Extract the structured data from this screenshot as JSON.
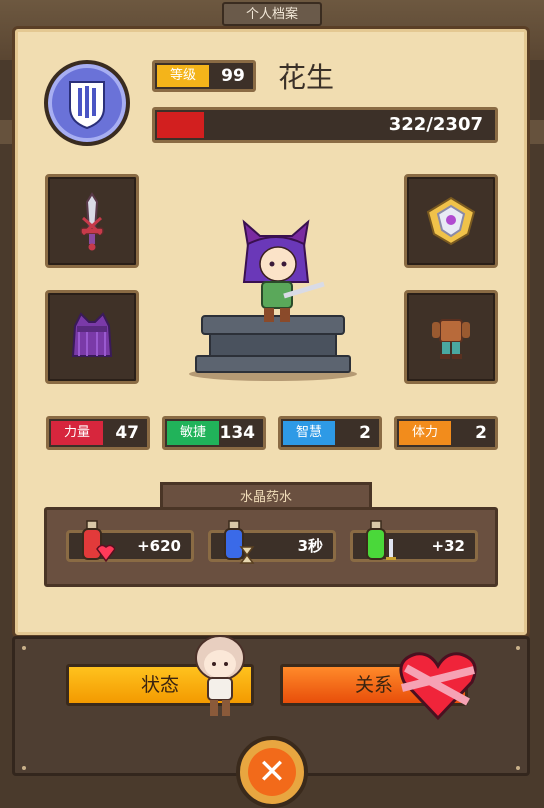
{
  "header": {
    "tab_title": "个人档案"
  },
  "profile": {
    "level_label": "等级",
    "level": "99",
    "name": "花生",
    "xp_text": "322/2307",
    "xp_current": 322,
    "xp_max": 2307
  },
  "equipment": [
    {
      "slot": "weapon",
      "icon": "sword-icon"
    },
    {
      "slot": "head",
      "icon": "hood-icon"
    },
    {
      "slot": "accessory",
      "icon": "shield-emblem-icon"
    },
    {
      "slot": "body",
      "icon": "armor-icon"
    }
  ],
  "stats": [
    {
      "label": "力量",
      "value": "47",
      "color": "#d7263d"
    },
    {
      "label": "敏捷",
      "value": "134",
      "color": "#21b35a"
    },
    {
      "label": "智慧",
      "value": "2",
      "color": "#2e9ae6"
    },
    {
      "label": "体力",
      "value": "2",
      "color": "#f28c1c"
    }
  ],
  "potions": {
    "title": "水晶药水",
    "items": [
      {
        "icon": "red-potion-heart-icon",
        "value": "+620"
      },
      {
        "icon": "blue-potion-hourglass-icon",
        "value": "3秒"
      },
      {
        "icon": "green-potion-sword-icon",
        "value": "+32"
      }
    ]
  },
  "buttons": {
    "status": "状态",
    "relations": "关系"
  },
  "colors": {
    "panel": "#f1ddb1",
    "xp_fill": "#d21f1f",
    "level_tag": "#f4b41a"
  }
}
